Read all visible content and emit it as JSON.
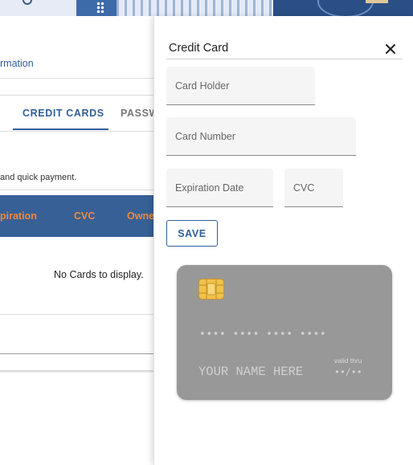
{
  "background_page": {
    "link_fragment": "rmation",
    "tabs": [
      {
        "label": "CREDIT CARDS",
        "active": true
      },
      {
        "label": "PASSW",
        "active": false
      }
    ],
    "helper_text": " and quick payment.",
    "table_headers": [
      "piration",
      "CVC",
      "Owne"
    ],
    "empty_message": "No Cards to display."
  },
  "drawer": {
    "title": "Credit Card",
    "fields": {
      "card_holder_placeholder": "Card Holder",
      "card_number_placeholder": "Card Number",
      "expiration_placeholder": "Expiration Date",
      "cvc_placeholder": "CVC"
    },
    "save_label": "SAVE"
  },
  "card_preview": {
    "number": "•••• •••• •••• ••••",
    "name": "YOUR NAME HERE",
    "valid_thru_label": "valid thru",
    "valid_thru_value": "••/••",
    "background_color": "#989898"
  },
  "colors": {
    "accent_blue": "#2f5f9a",
    "table_header_bg": "#376097",
    "table_header_text": "#ee8a3c"
  }
}
